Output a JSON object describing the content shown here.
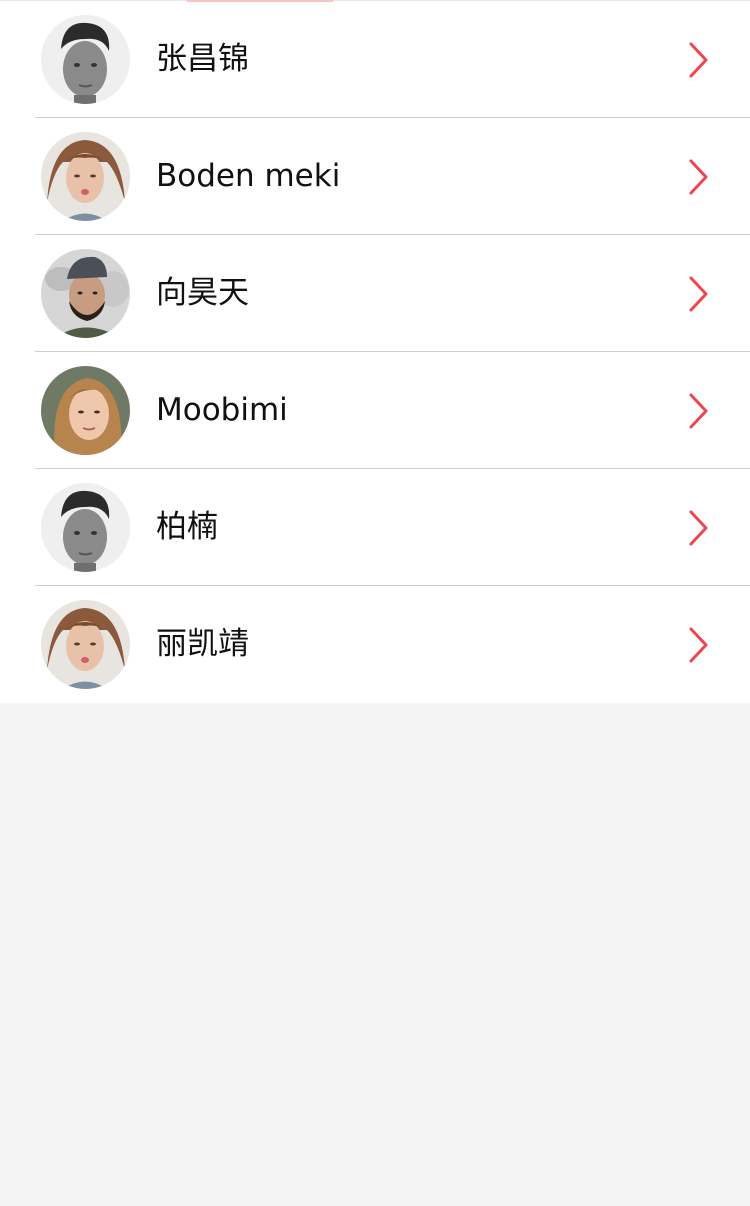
{
  "colors": {
    "accent": "#f0444e",
    "background": "#f4f4f4",
    "row_background": "#ffffff",
    "divider": "#cfcfcf",
    "text": "#111111"
  },
  "contacts": [
    {
      "name": "张昌锦",
      "avatar": "man-portrait-bw",
      "icon": "chevron-right-icon"
    },
    {
      "name": "Boden meki",
      "avatar": "woman-kiss-portrait",
      "icon": "chevron-right-icon"
    },
    {
      "name": "向昊天",
      "avatar": "bearded-man-cap-portrait",
      "icon": "chevron-right-icon"
    },
    {
      "name": "Moobimi",
      "avatar": "woman-blonde-portrait",
      "icon": "chevron-right-icon"
    },
    {
      "name": "柏楠",
      "avatar": "man-portrait-bw",
      "icon": "chevron-right-icon"
    },
    {
      "name": "丽凯靖",
      "avatar": "woman-kiss-portrait",
      "icon": "chevron-right-icon"
    }
  ]
}
